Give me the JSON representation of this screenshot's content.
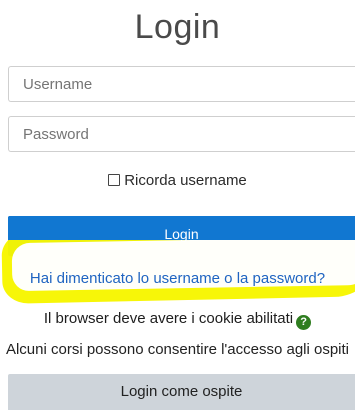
{
  "login": {
    "title": "Login",
    "username_placeholder": "Username",
    "password_placeholder": "Password",
    "remember_label": "Ricorda username",
    "login_button": "Login",
    "forgot_link": "Hai dimenticato lo username o la password?",
    "cookies_notice": "Il browser deve avere i cookie abilitati",
    "help_icon_glyph": "?",
    "guest_notice": "Alcuni corsi possono consentire l'accesso agli ospiti",
    "guest_button": "Login come ospite"
  },
  "colors": {
    "primary": "#1177d1",
    "link": "#1f64c1",
    "highlight": "#f7f600",
    "help_icon": "#2f7d1f",
    "secondary_button": "#ced4da"
  }
}
